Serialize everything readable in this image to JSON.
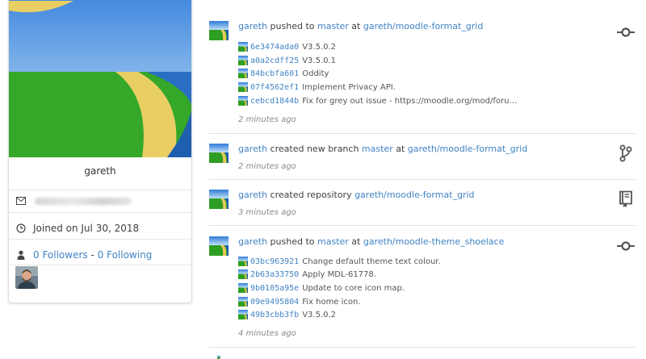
{
  "profile": {
    "username": "gareth",
    "joined": "Joined on Jul 30, 2018",
    "followers": "0 Followers",
    "separator": " - ",
    "following": "0 Following"
  },
  "feed": [
    {
      "user": "gareth",
      "action": " pushed to ",
      "ref": "master",
      "at": " at ",
      "repo": "gareth/moodle-format_grid",
      "commits": [
        {
          "sha": "6e3474ada0",
          "message": "V3.5.0.2"
        },
        {
          "sha": "a0a2cdff25",
          "message": "V3.5.0.1"
        },
        {
          "sha": "84bcbfa601",
          "message": "Oddity"
        },
        {
          "sha": "07f4562ef1",
          "message": "Implement Privacy API."
        },
        {
          "sha": "cebcd1844b",
          "message": "Fix for grey out issue - https://moodle.org/mod/foru…"
        }
      ],
      "time": "2 minutes ago",
      "icon": "git-commit-icon"
    },
    {
      "user": "gareth",
      "action": " created new branch ",
      "ref": "master",
      "at": " at ",
      "repo": "gareth/moodle-format_grid",
      "commits": [],
      "time": "2 minutes ago",
      "icon": "git-branch-icon"
    },
    {
      "user": "gareth",
      "action": " created repository ",
      "ref": "",
      "at": "",
      "repo": "gareth/moodle-format_grid",
      "commits": [],
      "time": "3 minutes ago",
      "icon": "repo-icon"
    },
    {
      "user": "gareth",
      "action": " pushed to ",
      "ref": "master",
      "at": " at ",
      "repo": "gareth/moodle-theme_shoelace",
      "commits": [
        {
          "sha": "03bc963921",
          "message": "Change default theme text colour."
        },
        {
          "sha": "2b63a33750",
          "message": "Apply MDL-61778."
        },
        {
          "sha": "9b0105a95e",
          "message": "Update to core icon map."
        },
        {
          "sha": "09e9495804",
          "message": "Fix home icon."
        },
        {
          "sha": "49b3cbb3fb",
          "message": "V3.5.0.2"
        }
      ],
      "time": "4 minutes ago",
      "icon": "git-commit-icon"
    }
  ],
  "colors": {
    "link": "#4183c4",
    "text": "#404040",
    "muted": "#8a8a8a",
    "icon": "#555555"
  }
}
